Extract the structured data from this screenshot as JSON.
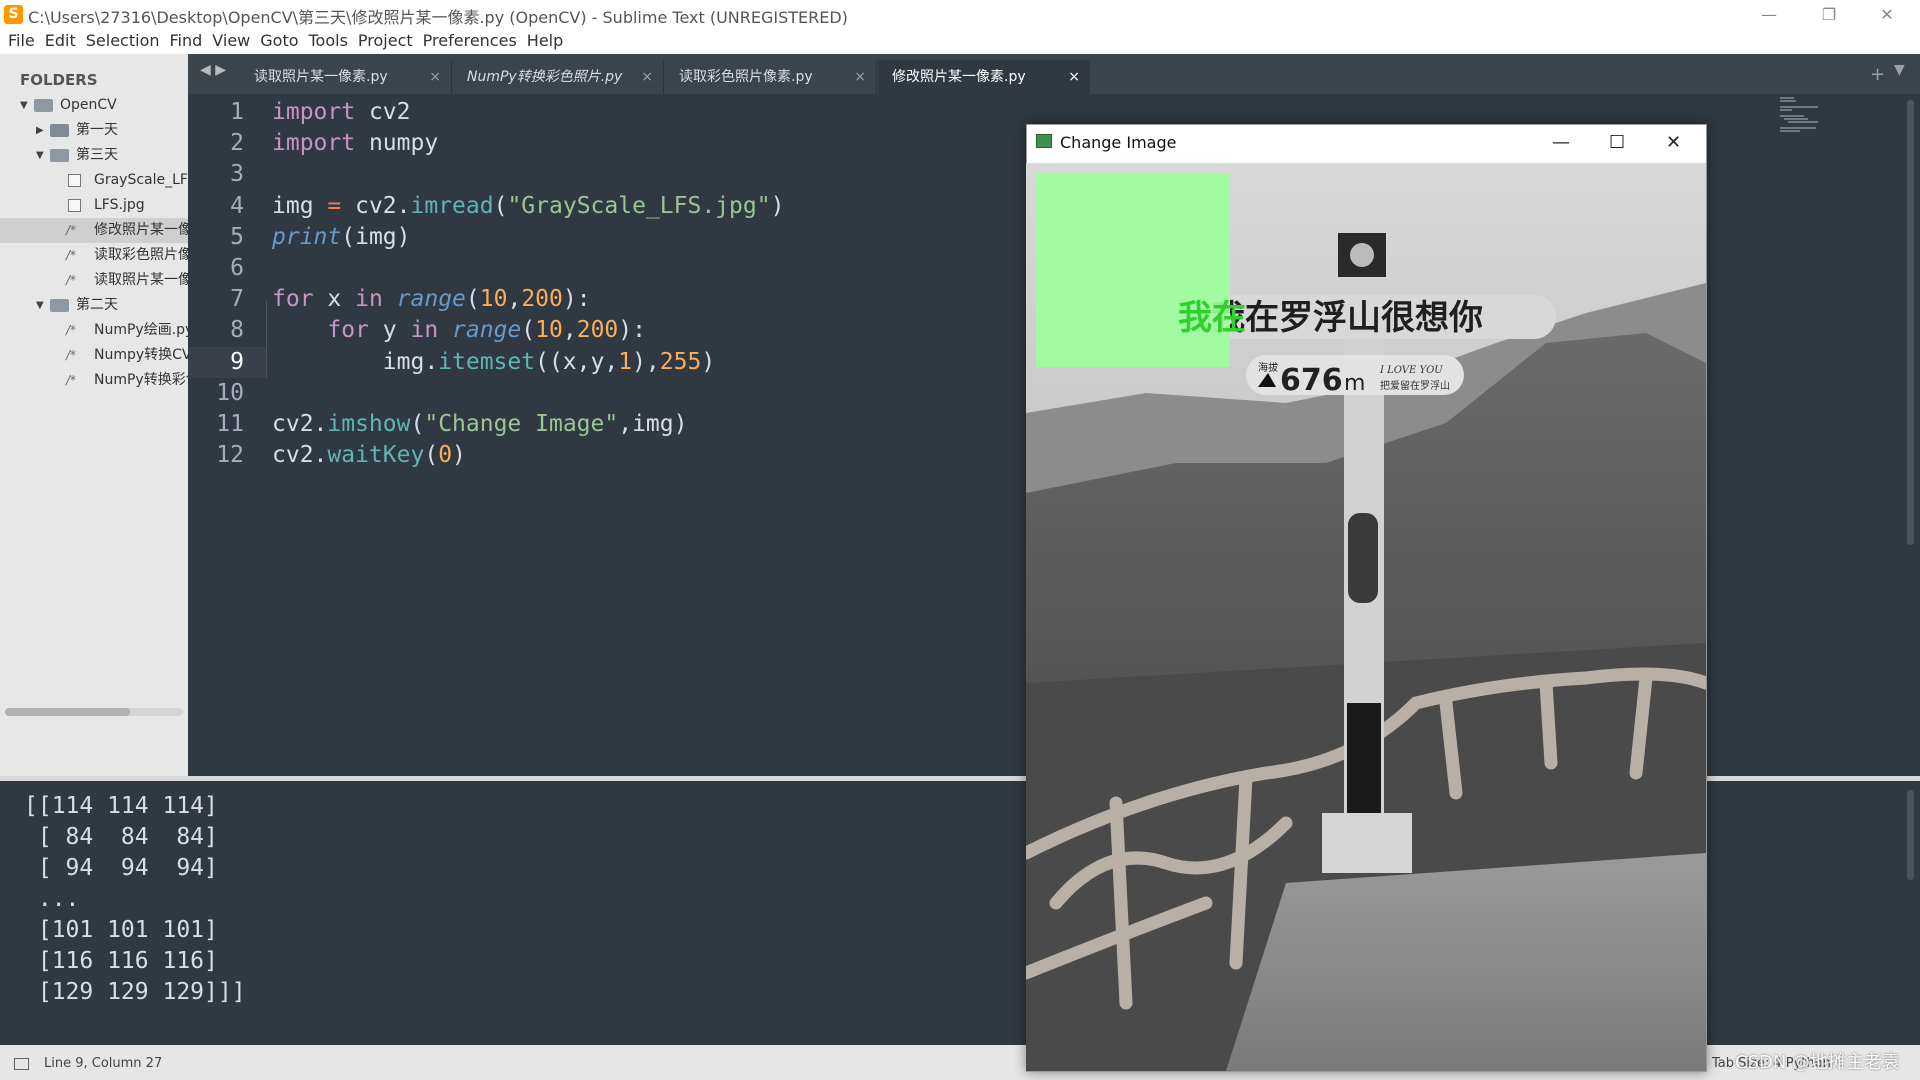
{
  "window": {
    "title": "C:\\Users\\27316\\Desktop\\OpenCV\\第三天\\修改照片某一像素.py (OpenCV) - Sublime Text (UNREGISTERED)",
    "app_icon_glyph": "S",
    "minimize": "—",
    "restore": "❐",
    "close": "✕"
  },
  "menu": [
    "File",
    "Edit",
    "Selection",
    "Find",
    "View",
    "Goto",
    "Tools",
    "Project",
    "Preferences",
    "Help"
  ],
  "sidebar": {
    "header": "FOLDERS",
    "items": [
      {
        "label": "OpenCV",
        "type": "folder-open",
        "level": 0
      },
      {
        "label": "第一天",
        "type": "folder-closed",
        "level": 1
      },
      {
        "label": "第三天",
        "type": "folder-open",
        "level": 1
      },
      {
        "label": "GrayScale_LFS.jpg",
        "type": "image",
        "level": 2
      },
      {
        "label": "LFS.jpg",
        "type": "image",
        "level": 2
      },
      {
        "label": "修改照片某一像素.py",
        "type": "code",
        "level": 2,
        "selected": true
      },
      {
        "label": "读取彩色照片像素.py",
        "type": "code",
        "level": 2
      },
      {
        "label": "读取照片某一像素.py",
        "type": "code",
        "level": 2
      },
      {
        "label": "第二天",
        "type": "folder-open",
        "level": 1
      },
      {
        "label": "NumPy绘画.py",
        "type": "code",
        "level": 2
      },
      {
        "label": "Numpy转换CV.py",
        "type": "code",
        "level": 2
      },
      {
        "label": "NumPy转换彩色照片.py",
        "type": "code",
        "level": 2
      }
    ]
  },
  "tabs": [
    {
      "label": "读取照片某一像素.py",
      "active": false,
      "italic": false
    },
    {
      "label": "NumPy转换彩色照片.py",
      "active": false,
      "italic": true
    },
    {
      "label": "读取彩色照片像素.py",
      "active": false,
      "italic": false
    },
    {
      "label": "修改照片某一像素.py",
      "active": true,
      "italic": false
    }
  ],
  "tab_close": "×",
  "tab_nav": "◀ ▶",
  "tab_add": "+",
  "tab_menu": "▼",
  "editor": {
    "current_line": 9,
    "lines": [
      [
        {
          "t": "import",
          "c": "kw"
        },
        {
          "t": " cv2",
          "c": ""
        }
      ],
      [
        {
          "t": "import",
          "c": "kw"
        },
        {
          "t": " numpy",
          "c": ""
        }
      ],
      [],
      [
        {
          "t": "img ",
          "c": ""
        },
        {
          "t": "=",
          "c": "op"
        },
        {
          "t": " cv2.",
          "c": ""
        },
        {
          "t": "imread",
          "c": "fn"
        },
        {
          "t": "(",
          "c": ""
        },
        {
          "t": "\"GrayScale_LFS.jpg\"",
          "c": "str"
        },
        {
          "t": ")",
          "c": ""
        }
      ],
      [
        {
          "t": "print",
          "c": "it"
        },
        {
          "t": "(img)",
          "c": ""
        }
      ],
      [],
      [
        {
          "t": "for",
          "c": "kw"
        },
        {
          "t": " x ",
          "c": ""
        },
        {
          "t": "in",
          "c": "kw"
        },
        {
          "t": " ",
          "c": ""
        },
        {
          "t": "range",
          "c": "it"
        },
        {
          "t": "(",
          "c": ""
        },
        {
          "t": "10",
          "c": "num"
        },
        {
          "t": ",",
          "c": ""
        },
        {
          "t": "200",
          "c": "num"
        },
        {
          "t": "):",
          "c": ""
        }
      ],
      [
        {
          "t": "    ",
          "c": ""
        },
        {
          "t": "for",
          "c": "kw"
        },
        {
          "t": " y ",
          "c": ""
        },
        {
          "t": "in",
          "c": "kw"
        },
        {
          "t": " ",
          "c": ""
        },
        {
          "t": "range",
          "c": "it"
        },
        {
          "t": "(",
          "c": ""
        },
        {
          "t": "10",
          "c": "num"
        },
        {
          "t": ",",
          "c": ""
        },
        {
          "t": "200",
          "c": "num"
        },
        {
          "t": "):",
          "c": ""
        }
      ],
      [
        {
          "t": "        img.",
          "c": ""
        },
        {
          "t": "itemset",
          "c": "fn"
        },
        {
          "t": "((x,y,",
          "c": ""
        },
        {
          "t": "1",
          "c": "num"
        },
        {
          "t": "),",
          "c": ""
        },
        {
          "t": "255",
          "c": "num"
        },
        {
          "t": ")",
          "c": ""
        }
      ],
      [],
      [
        {
          "t": "cv2.",
          "c": ""
        },
        {
          "t": "imshow",
          "c": "fn"
        },
        {
          "t": "(",
          "c": ""
        },
        {
          "t": "\"Change Image\"",
          "c": "str"
        },
        {
          "t": ",img)",
          "c": ""
        }
      ],
      [
        {
          "t": "cv2.",
          "c": ""
        },
        {
          "t": "waitKey",
          "c": "fn"
        },
        {
          "t": "(",
          "c": ""
        },
        {
          "t": "0",
          "c": "num"
        },
        {
          "t": ")",
          "c": ""
        }
      ]
    ]
  },
  "output": {
    "lines": [
      "[[114 114 114]",
      " [ 84  84  84]",
      " [ 94  94  94]",
      " ...",
      " [101 101 101]",
      " [116 116 116]",
      " [129 129 129]]]"
    ]
  },
  "status": {
    "position": "Line 9, Column 27",
    "right": "Tab Size: 4     Python"
  },
  "watermark": "CSDN @地摊主老袁",
  "image_window": {
    "title": "Change Image",
    "minimize": "—",
    "maximize": "☐",
    "close": "✕",
    "sign_text": "我在罗浮山很想你",
    "sign_altitude_label": "海拔",
    "sign_altitude": "676",
    "sign_unit": "m",
    "sign_small": "把爱留在罗浮山",
    "sign_love": "I LOVE YOU",
    "overlay_color": "#9cff9c"
  },
  "colors": {
    "editor_bg": "#303841",
    "sidebar_bg": "#e7e7e7",
    "tab_bar": "#3b434b",
    "accent": "#f9ae58"
  }
}
